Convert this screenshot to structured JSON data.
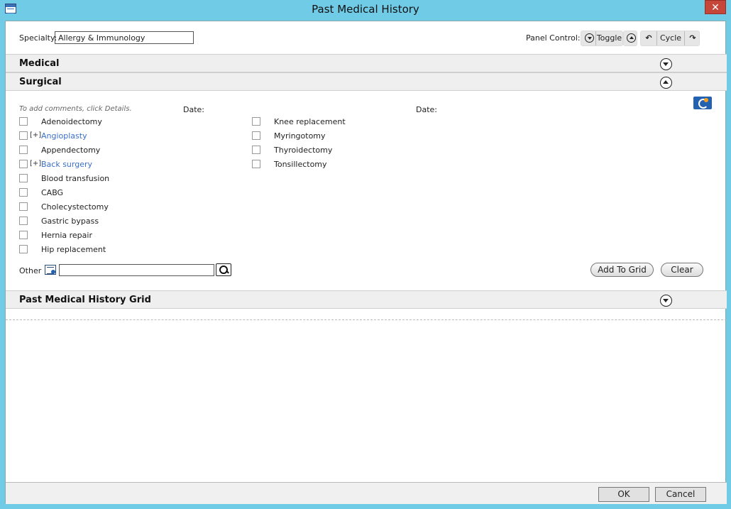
{
  "window": {
    "title": "Past Medical History",
    "close_glyph": "✕"
  },
  "specialty": {
    "label": "Specialty:",
    "value": "Allergy & Immunology"
  },
  "panel_control": {
    "label": "Panel Control:",
    "toggle_label": "Toggle",
    "cycle_label": "Cycle",
    "undo_glyph": "↶",
    "redo_glyph": "↷"
  },
  "sections": {
    "medical": {
      "label": "Medical"
    },
    "surgical": {
      "label": "Surgical"
    },
    "grid": {
      "label": "Past Medical History Grid"
    }
  },
  "surgical": {
    "hint": "To add comments, click Details.",
    "date_label": "Date:",
    "expander": "[+]",
    "left_items": [
      {
        "label": "Adenoidectomy",
        "link": false,
        "expandable": false
      },
      {
        "label": "Angioplasty",
        "link": true,
        "expandable": true
      },
      {
        "label": "Appendectomy",
        "link": false,
        "expandable": false
      },
      {
        "label": "Back surgery",
        "link": true,
        "expandable": true
      },
      {
        "label": "Blood transfusion",
        "link": false,
        "expandable": false
      },
      {
        "label": "CABG",
        "link": false,
        "expandable": false
      },
      {
        "label": "Cholecystectomy",
        "link": false,
        "expandable": false
      },
      {
        "label": "Gastric bypass",
        "link": false,
        "expandable": false
      },
      {
        "label": "Hernia repair",
        "link": false,
        "expandable": false
      },
      {
        "label": "Hip replacement",
        "link": false,
        "expandable": false
      }
    ],
    "right_items": [
      {
        "label": "Knee replacement"
      },
      {
        "label": "Myringotomy"
      },
      {
        "label": "Thyroidectomy"
      },
      {
        "label": "Tonsillectomy"
      }
    ],
    "other_label": "Other",
    "other_value": "",
    "add_to_grid_label": "Add To Grid",
    "clear_label": "Clear"
  },
  "footer": {
    "ok_label": "OK",
    "cancel_label": "Cancel"
  },
  "icons": {
    "app": "window-list-icon",
    "search": "magnifier-icon",
    "badge": "clinical-info-icon"
  },
  "colors": {
    "titlebar": "#6fcbe6",
    "link": "#3a6fc9",
    "close": "#c7463a"
  }
}
